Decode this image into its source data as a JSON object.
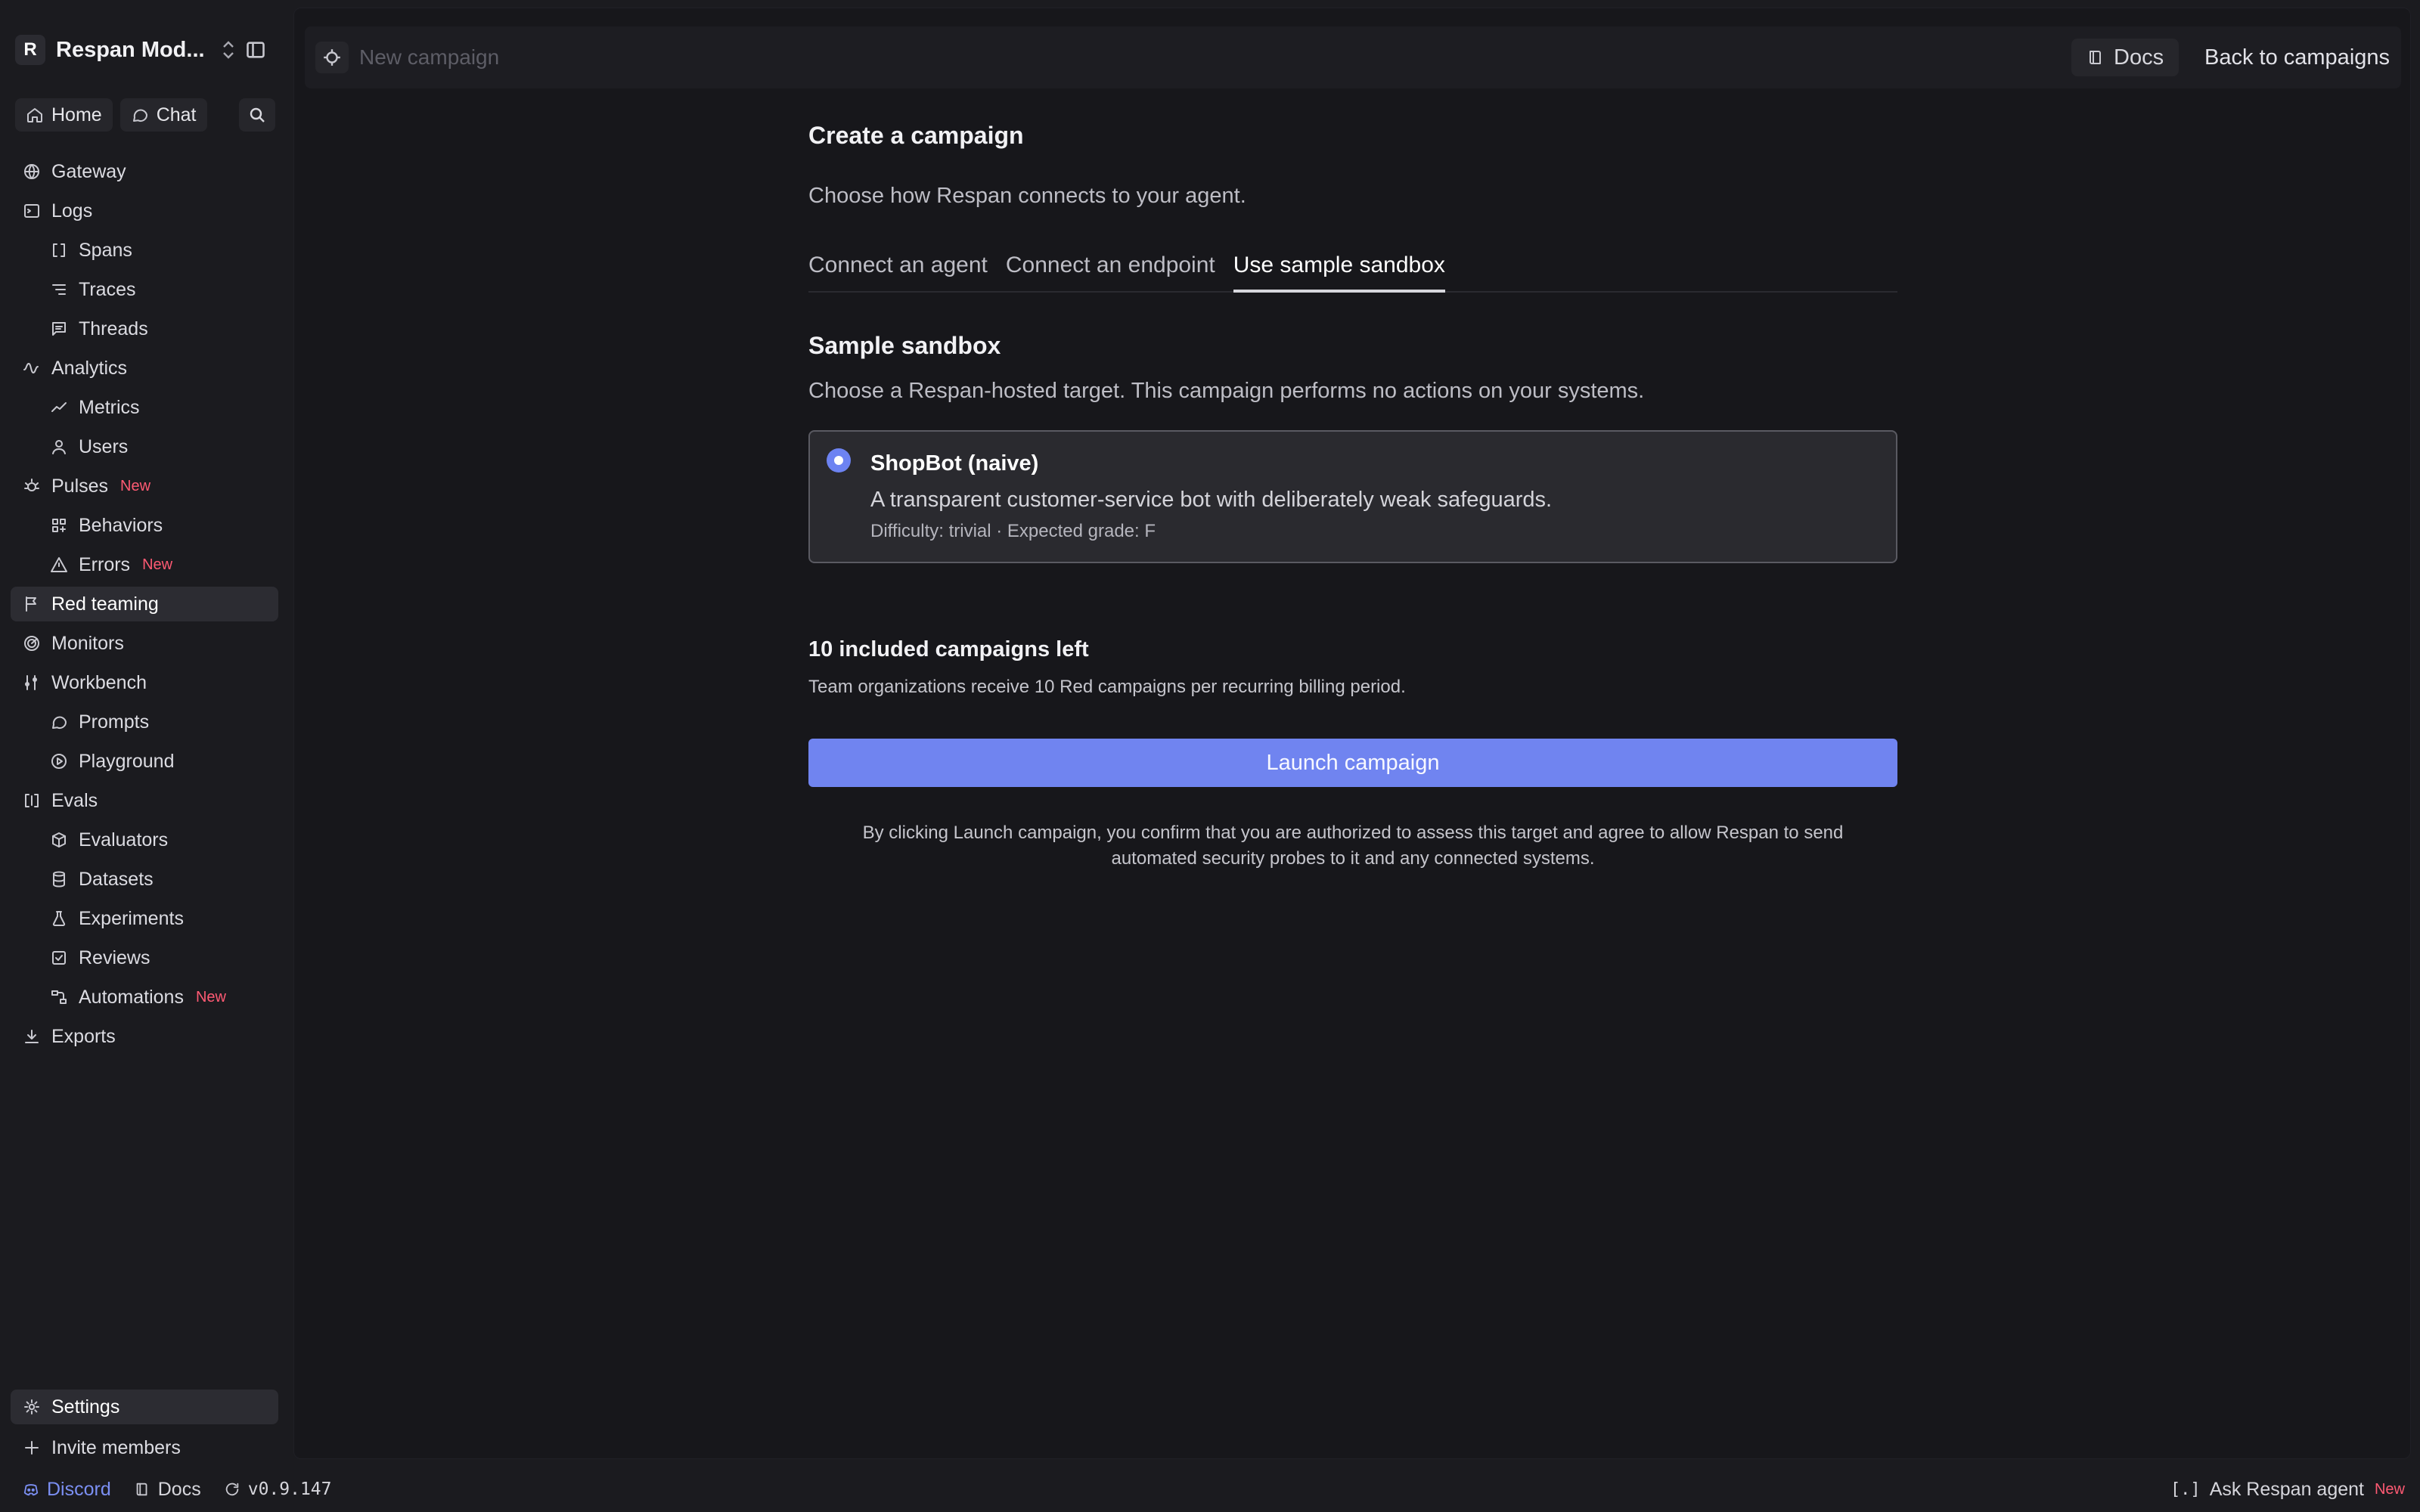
{
  "sidebar": {
    "workspace": {
      "avatar_letter": "R",
      "name": "Respan Mod..."
    },
    "quick": {
      "home": "Home",
      "chat": "Chat"
    },
    "items": [
      {
        "label": "Gateway",
        "icon": "globe-icon",
        "child": false
      },
      {
        "label": "Logs",
        "icon": "terminal-icon",
        "child": false
      },
      {
        "label": "Spans",
        "icon": "brackets-icon",
        "child": true
      },
      {
        "label": "Traces",
        "icon": "list-tree-icon",
        "child": true
      },
      {
        "label": "Threads",
        "icon": "message-square-icon",
        "child": true
      },
      {
        "label": "Analytics",
        "icon": "activity-icon",
        "child": false
      },
      {
        "label": "Metrics",
        "icon": "trend-icon",
        "child": true
      },
      {
        "label": "Users",
        "icon": "user-icon",
        "child": true
      },
      {
        "label": "Pulses",
        "icon": "sun-bug-icon",
        "child": false,
        "badge": "New"
      },
      {
        "label": "Behaviors",
        "icon": "grid-icon",
        "child": true
      },
      {
        "label": "Errors",
        "icon": "warning-icon",
        "child": true,
        "badge": "New"
      },
      {
        "label": "Red teaming",
        "icon": "flag-icon",
        "child": false,
        "active": true
      },
      {
        "label": "Monitors",
        "icon": "radar-icon",
        "child": false
      },
      {
        "label": "Workbench",
        "icon": "tools-icon",
        "child": false
      },
      {
        "label": "Prompts",
        "icon": "chat-bubble-icon",
        "child": true
      },
      {
        "label": "Playground",
        "icon": "play-circle-icon",
        "child": true
      },
      {
        "label": "Evals",
        "icon": "columns-icon",
        "child": false
      },
      {
        "label": "Evaluators",
        "icon": "box-icon",
        "child": true
      },
      {
        "label": "Datasets",
        "icon": "database-icon",
        "child": true
      },
      {
        "label": "Experiments",
        "icon": "flask-icon",
        "child": true
      },
      {
        "label": "Reviews",
        "icon": "check-square-icon",
        "child": true
      },
      {
        "label": "Automations",
        "icon": "workflow-icon",
        "child": true,
        "badge": "New"
      },
      {
        "label": "Exports",
        "icon": "download-icon",
        "child": false
      }
    ],
    "bottom": {
      "settings": "Settings",
      "invite": "Invite members"
    }
  },
  "footer": {
    "discord": "Discord",
    "docs": "Docs",
    "version": "v0.9.147",
    "ask_bracket": "[.]",
    "ask": "Ask Respan agent",
    "ask_badge": "New"
  },
  "topbar": {
    "title_placeholder": "New campaign",
    "docs": "Docs",
    "back": "Back to campaigns"
  },
  "content": {
    "title": "Create a campaign",
    "subtitle": "Choose how Respan connects to your agent.",
    "tabs": [
      {
        "label": "Connect an agent",
        "active": false
      },
      {
        "label": "Connect an endpoint",
        "active": false
      },
      {
        "label": "Use sample sandbox",
        "active": true
      }
    ],
    "section_title": "Sample sandbox",
    "section_sub": "Choose a Respan-hosted target. This campaign performs no actions on your systems.",
    "card": {
      "title": "ShopBot (naive)",
      "description": "A transparent customer-service bot with deliberately weak safeguards.",
      "meta": "Difficulty: trivial · Expected grade: F",
      "selected": true
    },
    "quota_title": "10 included campaigns left",
    "quota_sub": "Team organizations receive 10 Red campaigns per recurring billing period.",
    "launch": "Launch campaign",
    "legal_line1": "By clicking Launch campaign, you confirm that you are authorized to assess this target and agree to allow Respan to send",
    "legal_line2": "automated security probes to it and any connected systems."
  },
  "colors": {
    "accent": "#7084f0",
    "new_badge": "#ff5a73",
    "discord": "#7b8ff2",
    "background": "#1b1b1f"
  }
}
